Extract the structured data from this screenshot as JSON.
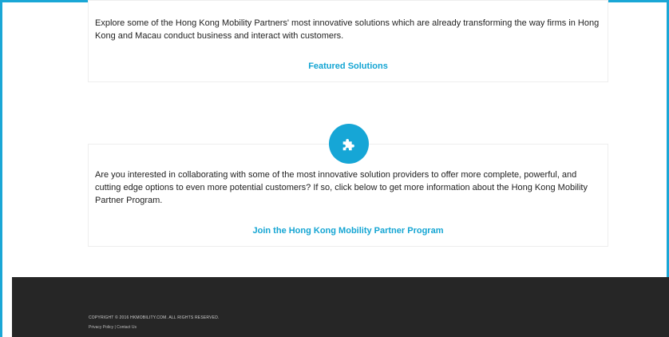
{
  "section1": {
    "text": "Explore some of the Hong Kong Mobility Partners' most innovative solutions which are already transforming the way firms in Hong Kong and Macau conduct business and interact with customers.",
    "link": "Featured Solutions"
  },
  "section2": {
    "icon": "puzzle-icon",
    "text": "Are you interested in collaborating with some of the most innovative solution providers to offer more complete, powerful, and cutting edge options to even more potential customers? If so, click below to get more information about the Hong Kong Mobility Partner Program.",
    "link": "Join the Hong Kong Mobility Partner Program"
  },
  "footer": {
    "copyright": "COPYRIGHT © 2016 HKMOBILITY.COM. ALL RIGHTS RESERVED.",
    "privacy": "Privacy Policy",
    "separator": "|",
    "contact": "Contact Us"
  },
  "colors": {
    "accent": "#16a6d6",
    "footer_bg": "#262626"
  }
}
